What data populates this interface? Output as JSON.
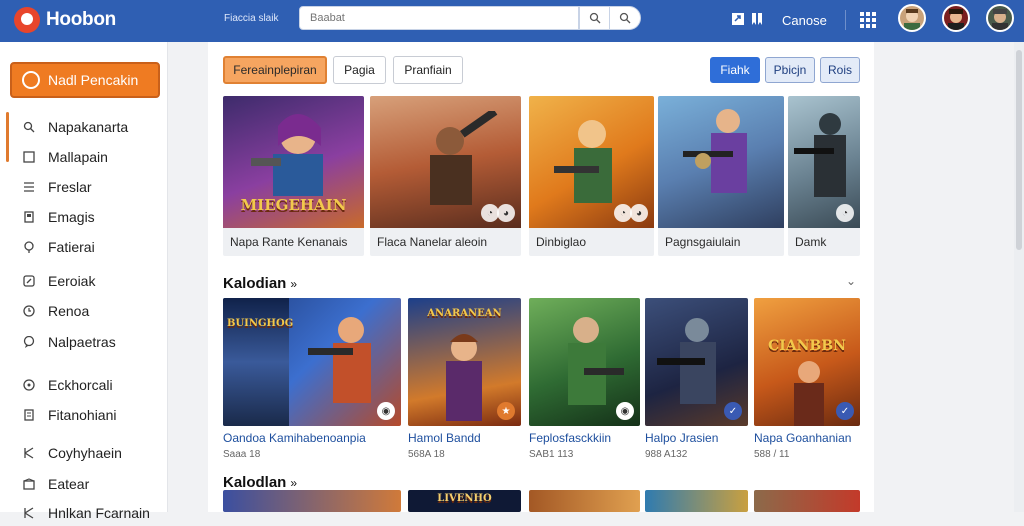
{
  "app": {
    "name": "Hoobon"
  },
  "header": {
    "small_text": "Fiaccia slaik",
    "search_placeholder": "Baabat",
    "account_label": "Canose",
    "icons": [
      "search-icon",
      "filter-search-icon",
      "share-icon",
      "bookmark-icon",
      "apps-grid-icon"
    ]
  },
  "sidebar": {
    "new_button": "Nadl Pencakin",
    "items": [
      {
        "label": "Napakanarta",
        "icon": "search-icon"
      },
      {
        "label": "Mallapain",
        "icon": "grid-icon"
      },
      {
        "label": "Freslar",
        "icon": "list-icon"
      },
      {
        "label": "Emagis",
        "icon": "image-icon"
      },
      {
        "label": "Fatierai",
        "icon": "pin-icon"
      },
      {
        "label": "Eeroiak",
        "icon": "link-icon"
      },
      {
        "label": "Renoa",
        "icon": "clock-icon"
      },
      {
        "label": "Nalpaetras",
        "icon": "chat-icon"
      },
      {
        "label": "Eckhorcali",
        "icon": "circle-icon"
      },
      {
        "label": "Fitanohiani",
        "icon": "doc-icon"
      },
      {
        "label": "Coyhyhaein",
        "icon": "tool-icon"
      },
      {
        "label": "Eatear",
        "icon": "box-icon"
      },
      {
        "label": "Hnlkan Fcarnain",
        "icon": "tool-icon"
      }
    ]
  },
  "filters": [
    {
      "label": "Fereainplepiran",
      "active": true
    },
    {
      "label": "Pagia",
      "active": false
    },
    {
      "label": "Pranfiain",
      "active": false
    }
  ],
  "view_buttons": [
    {
      "label": "Fiahk",
      "active": true
    },
    {
      "label": "Pbicjn",
      "active": false
    },
    {
      "label": "Rois",
      "active": false
    }
  ],
  "featured": [
    {
      "caption": "Napa Rante Kenanais",
      "art_title": "MIEGEHAIN",
      "bg": "#5a3d8c"
    },
    {
      "caption": "Flaca Nanelar aleoin",
      "art_title": "",
      "bg": "#a35a34"
    },
    {
      "caption": "Dinbiglao",
      "art_title": "",
      "bg": "#d98a2b"
    },
    {
      "caption": "Pagnsgaiulain",
      "art_title": "",
      "bg": "#4f7fb9"
    },
    {
      "caption": "Damk",
      "art_title": "",
      "bg": "#6e8a9a"
    }
  ],
  "sections": [
    {
      "title": "Kalodian",
      "arrow": "»"
    },
    {
      "title": "Kalodlan",
      "arrow": "»"
    }
  ],
  "games": [
    {
      "title": "Oandoa Kamihabenoanpia",
      "meta": "Saaa 18",
      "art_title": "BUINGHOG",
      "bg": "#1f3a74"
    },
    {
      "title": "Hamol Bandd",
      "meta": "568A 18",
      "art_title": "ANARANEAN",
      "bg": "#22488f"
    },
    {
      "title": "Feplosfasckkiin",
      "meta": "SAB1 113",
      "art_title": "",
      "bg": "#2f6b33"
    },
    {
      "title": "Halpo Jrasien",
      "meta": "988 A132",
      "art_title": "",
      "bg": "#1d2442"
    },
    {
      "title": "Napa Goanhanian",
      "meta": "588 / 11",
      "art_title": "CIANBBN",
      "bg": "#c7591a"
    }
  ],
  "bottom_row": [
    {
      "art_title": "",
      "bg": "#3b4fa0"
    },
    {
      "art_title": "LIVENHO",
      "bg": "#0f1935"
    },
    {
      "art_title": "",
      "bg": "#a35825"
    },
    {
      "art_title": "",
      "bg": "#2f7bb0"
    },
    {
      "art_title": "",
      "bg": "#8c6a4a"
    }
  ]
}
